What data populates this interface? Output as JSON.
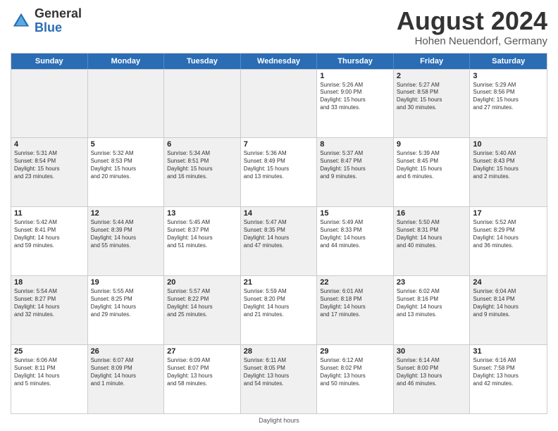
{
  "header": {
    "logo_general": "General",
    "logo_blue": "Blue",
    "title": "August 2024",
    "location": "Hohen Neuendorf, Germany"
  },
  "days_of_week": [
    "Sunday",
    "Monday",
    "Tuesday",
    "Wednesday",
    "Thursday",
    "Friday",
    "Saturday"
  ],
  "weeks": [
    [
      {
        "day": "",
        "text": "",
        "shaded": true
      },
      {
        "day": "",
        "text": "",
        "shaded": true
      },
      {
        "day": "",
        "text": "",
        "shaded": true
      },
      {
        "day": "",
        "text": "",
        "shaded": true
      },
      {
        "day": "1",
        "text": "Sunrise: 5:26 AM\nSunset: 9:00 PM\nDaylight: 15 hours\nand 33 minutes."
      },
      {
        "day": "2",
        "text": "Sunrise: 5:27 AM\nSunset: 8:58 PM\nDaylight: 15 hours\nand 30 minutes.",
        "shaded": true
      },
      {
        "day": "3",
        "text": "Sunrise: 5:29 AM\nSunset: 8:56 PM\nDaylight: 15 hours\nand 27 minutes."
      }
    ],
    [
      {
        "day": "4",
        "text": "Sunrise: 5:31 AM\nSunset: 8:54 PM\nDaylight: 15 hours\nand 23 minutes.",
        "shaded": true
      },
      {
        "day": "5",
        "text": "Sunrise: 5:32 AM\nSunset: 8:53 PM\nDaylight: 15 hours\nand 20 minutes."
      },
      {
        "day": "6",
        "text": "Sunrise: 5:34 AM\nSunset: 8:51 PM\nDaylight: 15 hours\nand 16 minutes.",
        "shaded": true
      },
      {
        "day": "7",
        "text": "Sunrise: 5:36 AM\nSunset: 8:49 PM\nDaylight: 15 hours\nand 13 minutes."
      },
      {
        "day": "8",
        "text": "Sunrise: 5:37 AM\nSunset: 8:47 PM\nDaylight: 15 hours\nand 9 minutes.",
        "shaded": true
      },
      {
        "day": "9",
        "text": "Sunrise: 5:39 AM\nSunset: 8:45 PM\nDaylight: 15 hours\nand 6 minutes."
      },
      {
        "day": "10",
        "text": "Sunrise: 5:40 AM\nSunset: 8:43 PM\nDaylight: 15 hours\nand 2 minutes.",
        "shaded": true
      }
    ],
    [
      {
        "day": "11",
        "text": "Sunrise: 5:42 AM\nSunset: 8:41 PM\nDaylight: 14 hours\nand 59 minutes."
      },
      {
        "day": "12",
        "text": "Sunrise: 5:44 AM\nSunset: 8:39 PM\nDaylight: 14 hours\nand 55 minutes.",
        "shaded": true
      },
      {
        "day": "13",
        "text": "Sunrise: 5:45 AM\nSunset: 8:37 PM\nDaylight: 14 hours\nand 51 minutes."
      },
      {
        "day": "14",
        "text": "Sunrise: 5:47 AM\nSunset: 8:35 PM\nDaylight: 14 hours\nand 47 minutes.",
        "shaded": true
      },
      {
        "day": "15",
        "text": "Sunrise: 5:49 AM\nSunset: 8:33 PM\nDaylight: 14 hours\nand 44 minutes."
      },
      {
        "day": "16",
        "text": "Sunrise: 5:50 AM\nSunset: 8:31 PM\nDaylight: 14 hours\nand 40 minutes.",
        "shaded": true
      },
      {
        "day": "17",
        "text": "Sunrise: 5:52 AM\nSunset: 8:29 PM\nDaylight: 14 hours\nand 36 minutes."
      }
    ],
    [
      {
        "day": "18",
        "text": "Sunrise: 5:54 AM\nSunset: 8:27 PM\nDaylight: 14 hours\nand 32 minutes.",
        "shaded": true
      },
      {
        "day": "19",
        "text": "Sunrise: 5:55 AM\nSunset: 8:25 PM\nDaylight: 14 hours\nand 29 minutes."
      },
      {
        "day": "20",
        "text": "Sunrise: 5:57 AM\nSunset: 8:22 PM\nDaylight: 14 hours\nand 25 minutes.",
        "shaded": true
      },
      {
        "day": "21",
        "text": "Sunrise: 5:59 AM\nSunset: 8:20 PM\nDaylight: 14 hours\nand 21 minutes."
      },
      {
        "day": "22",
        "text": "Sunrise: 6:01 AM\nSunset: 8:18 PM\nDaylight: 14 hours\nand 17 minutes.",
        "shaded": true
      },
      {
        "day": "23",
        "text": "Sunrise: 6:02 AM\nSunset: 8:16 PM\nDaylight: 14 hours\nand 13 minutes."
      },
      {
        "day": "24",
        "text": "Sunrise: 6:04 AM\nSunset: 8:14 PM\nDaylight: 14 hours\nand 9 minutes.",
        "shaded": true
      }
    ],
    [
      {
        "day": "25",
        "text": "Sunrise: 6:06 AM\nSunset: 8:11 PM\nDaylight: 14 hours\nand 5 minutes."
      },
      {
        "day": "26",
        "text": "Sunrise: 6:07 AM\nSunset: 8:09 PM\nDaylight: 14 hours\nand 1 minute.",
        "shaded": true
      },
      {
        "day": "27",
        "text": "Sunrise: 6:09 AM\nSunset: 8:07 PM\nDaylight: 13 hours\nand 58 minutes."
      },
      {
        "day": "28",
        "text": "Sunrise: 6:11 AM\nSunset: 8:05 PM\nDaylight: 13 hours\nand 54 minutes.",
        "shaded": true
      },
      {
        "day": "29",
        "text": "Sunrise: 6:12 AM\nSunset: 8:02 PM\nDaylight: 13 hours\nand 50 minutes."
      },
      {
        "day": "30",
        "text": "Sunrise: 6:14 AM\nSunset: 8:00 PM\nDaylight: 13 hours\nand 46 minutes.",
        "shaded": true
      },
      {
        "day": "31",
        "text": "Sunrise: 6:16 AM\nSunset: 7:58 PM\nDaylight: 13 hours\nand 42 minutes."
      }
    ]
  ],
  "footer": "Daylight hours"
}
